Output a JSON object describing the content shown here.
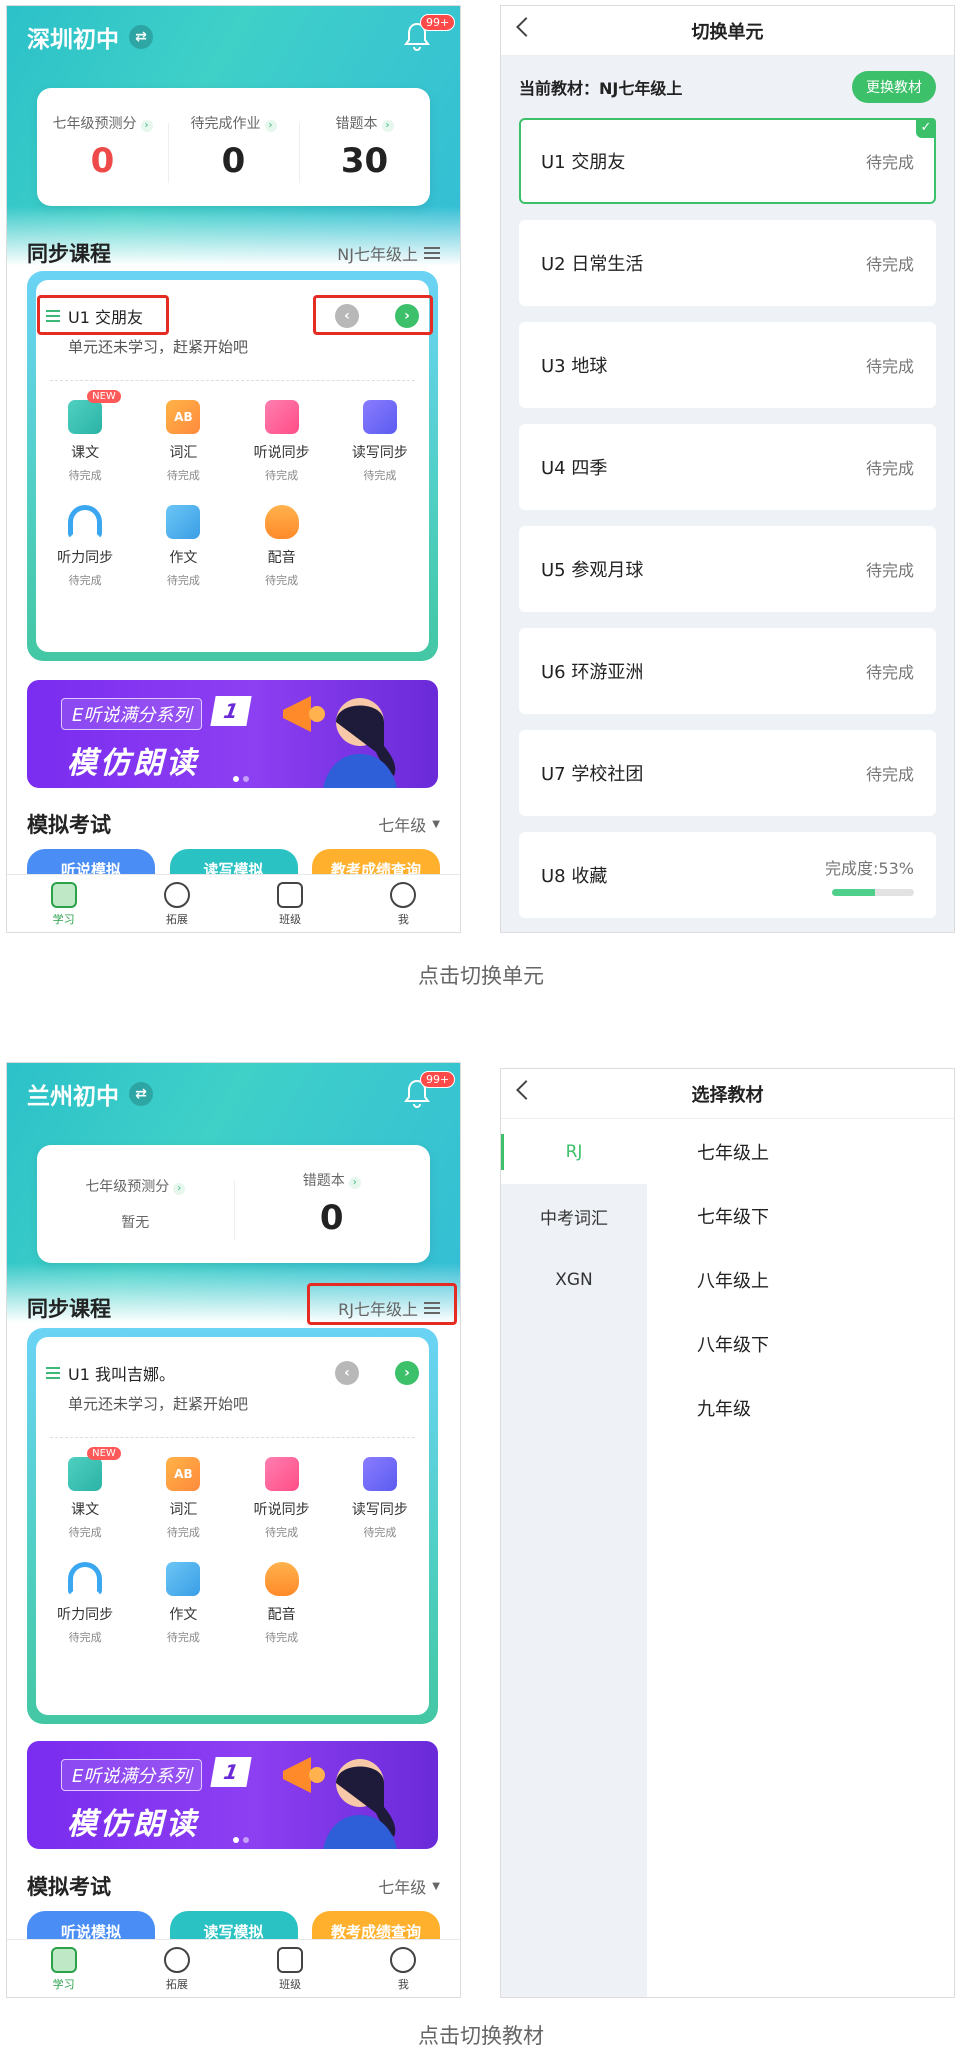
{
  "top_left": {
    "school": "深圳初中",
    "badge": "99+",
    "stats": [
      {
        "label": "七年级预测分",
        "value": "0",
        "color": "#ef4a4a"
      },
      {
        "label": "待完成作业",
        "value": "0"
      },
      {
        "label": "错题本",
        "value": "30"
      }
    ],
    "section_title": "同步课程",
    "book": "NJ七年级上",
    "unit_title": "U1 交朋友",
    "unit_sub": "单元还未学习，赶紧开始吧",
    "grid": [
      {
        "name": "课文",
        "status": "待完成",
        "new": "NEW"
      },
      {
        "name": "词汇",
        "status": "待完成",
        "glyph": "AB"
      },
      {
        "name": "听说同步",
        "status": "待完成"
      },
      {
        "name": "读写同步",
        "status": "待完成"
      },
      {
        "name": "听力同步",
        "status": "待完成"
      },
      {
        "name": "作文",
        "status": "待完成"
      },
      {
        "name": "配音",
        "status": "待完成"
      }
    ],
    "banner_t1": "E听说满分系列",
    "banner_num": "1",
    "banner_t2": "模仿朗读",
    "exam_title": "模拟考试",
    "exam_grade": "七年级",
    "exam_chips": [
      "听说模拟",
      "读写模拟",
      "教考成绩查询"
    ],
    "tabs": [
      "学习",
      "拓展",
      "班级",
      "我"
    ]
  },
  "top_right": {
    "title": "切换单元",
    "current": "当前教材：NJ七年级上",
    "change_btn": "更换教材",
    "units": [
      {
        "name": "U1 交朋友",
        "status": "待完成",
        "selected": true
      },
      {
        "name": "U2 日常生活",
        "status": "待完成"
      },
      {
        "name": "U3 地球",
        "status": "待完成"
      },
      {
        "name": "U4 四季",
        "status": "待完成"
      },
      {
        "name": "U5 参观月球",
        "status": "待完成"
      },
      {
        "name": "U6 环游亚洲",
        "status": "待完成"
      },
      {
        "name": "U7 学校社团",
        "status": "待完成"
      },
      {
        "name": "U8 收藏",
        "status": "完成度:53%",
        "progress": 0.53
      }
    ]
  },
  "caption1": "点击切换单元",
  "bottom_left": {
    "school": "兰州初中",
    "badge": "99+",
    "stats": [
      {
        "label": "七年级预测分",
        "value": "暂无"
      },
      {
        "label": "错题本",
        "value": "0"
      }
    ],
    "section_title": "同步课程",
    "book": "RJ七年级上",
    "unit_title": "U1 我叫吉娜。",
    "unit_sub": "单元还未学习，赶紧开始吧",
    "grid": [
      {
        "name": "课文",
        "status": "待完成",
        "new": "NEW"
      },
      {
        "name": "词汇",
        "status": "待完成",
        "glyph": "AB"
      },
      {
        "name": "听说同步",
        "status": "待完成"
      },
      {
        "name": "读写同步",
        "status": "待完成"
      },
      {
        "name": "听力同步",
        "status": "待完成"
      },
      {
        "name": "作文",
        "status": "待完成"
      },
      {
        "name": "配音",
        "status": "待完成"
      }
    ],
    "banner_t1": "E听说满分系列",
    "banner_num": "1",
    "banner_t2": "模仿朗读",
    "exam_title": "模拟考试",
    "exam_grade": "七年级",
    "exam_chips": [
      "听说模拟",
      "读写模拟",
      "教考成绩查询"
    ],
    "tabs": [
      "学习",
      "拓展",
      "班级",
      "我"
    ]
  },
  "bottom_right": {
    "title": "选择教材",
    "publishers": [
      "RJ",
      "中考词汇",
      "XGN"
    ],
    "grades": [
      "七年级上",
      "七年级下",
      "八年级上",
      "八年级下",
      "九年级"
    ]
  },
  "caption2": "点击切换教材",
  "icon_names": [
    "switch-icon",
    "bell-icon",
    "list-icon",
    "chevron-left-icon",
    "chevron-right-icon",
    "check-icon",
    "megaphone-icon"
  ],
  "colors": {
    "accent_green": "#3cc06a",
    "header_teal": "#2cc1c9",
    "red_highlight": "#e52c23",
    "banner_purple": "#7a2cf0"
  }
}
